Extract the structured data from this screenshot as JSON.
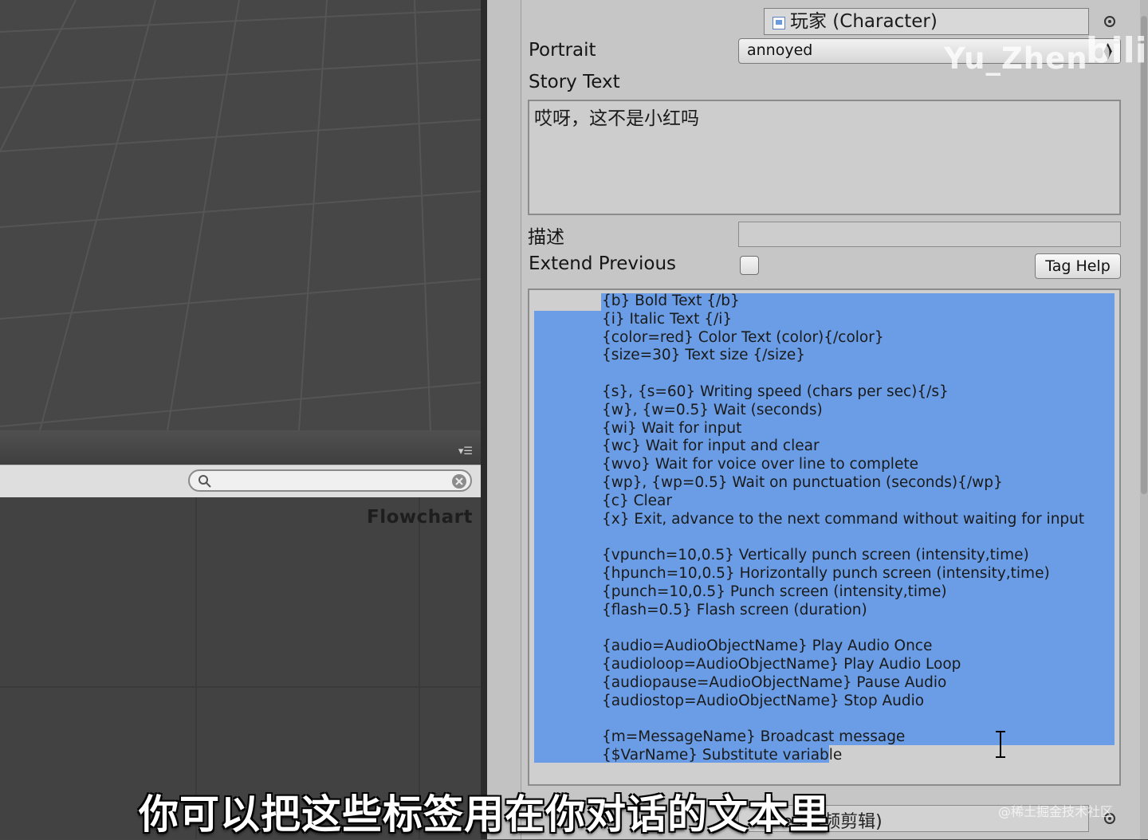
{
  "scene": {
    "name": "scene-view"
  },
  "hierarchy": {
    "menu_icon": "menu-icon",
    "search": {
      "value": "",
      "placeholder": ""
    }
  },
  "flowchart": {
    "title": "Flowchart"
  },
  "inspector": {
    "character": {
      "value": "玩家 (Character)",
      "icon": "character-icon"
    },
    "portrait": {
      "label": "Portrait",
      "value": "annoyed"
    },
    "story_text": {
      "label": "Story Text",
      "value": "哎呀，这不是小红吗"
    },
    "description": {
      "label": "描述",
      "value": ""
    },
    "extend_previous": {
      "label": "Extend Previous",
      "checked": false
    },
    "tag_help": {
      "label": "Tag Help"
    },
    "tags": [
      "{b} Bold Text {/b}",
      "{i} Italic Text {/i}",
      "{color=red} Color Text (color){/color}",
      "{size=30} Text size {/size}",
      "",
      "{s}, {s=60} Writing speed (chars per sec){/s}",
      "{w}, {w=0.5} Wait (seconds)",
      "{wi} Wait for input",
      "{wc} Wait for input and clear",
      "{wvo} Wait for voice over line to complete",
      "{wp}, {wp=0.5} Wait on punctuation (seconds){/wp}",
      "{c} Clear",
      "{x} Exit, advance to the next command without waiting for input",
      "",
      "{vpunch=10,0.5} Vertically punch screen (intensity,time)",
      "{hpunch=10,0.5} Horizontally punch screen (intensity,time)",
      "{punch=10,0.5} Punch screen (intensity,time)",
      "{flash=0.5} Flash screen (duration)",
      "",
      "{audio=AudioObjectName} Play Audio Once",
      "{audioloop=AudioObjectName} Play Audio Loop",
      "{audiopause=AudioObjectName} Pause Audio",
      "{audiostop=AudioObjectName} Stop Audio",
      "",
      "{m=MessageName} Broadcast message",
      "{$VarName} Substitute variable"
    ],
    "audio_clip": {
      "value": "e (音频剪辑)"
    }
  },
  "overlay": {
    "watermark": "Yu_Zhen",
    "watermark_logo": "bili",
    "site_watermark": "@稀土掘金技术社区",
    "subtitle": "你可以把这些标签用在你对话的文本里"
  },
  "colors": {
    "selection": "#6a9de6",
    "inspector_bg": "#c6c6c6",
    "scene_bg": "#474747"
  }
}
